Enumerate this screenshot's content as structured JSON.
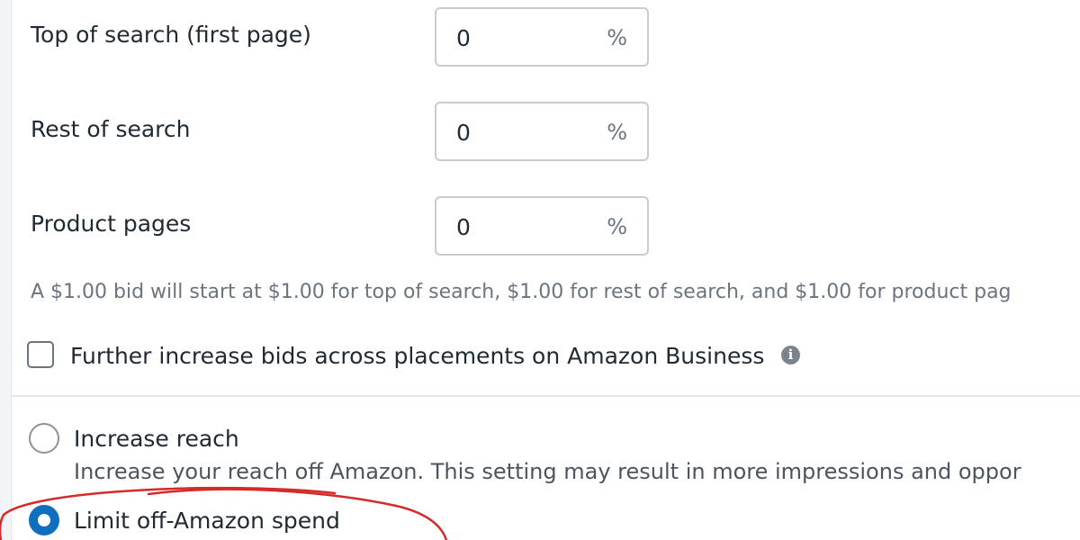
{
  "placements": {
    "rows": [
      {
        "label": "Top of search (first page)",
        "value": "0",
        "unit": "%"
      },
      {
        "label": "Rest of search",
        "value": "0",
        "unit": "%"
      },
      {
        "label": "Product pages",
        "value": "0",
        "unit": "%"
      }
    ],
    "helper_text": "A $1.00 bid will start at $1.00 for top of search, $1.00 for rest of search, and $1.00 for product pag"
  },
  "business_checkbox": {
    "label": "Further increase bids across placements on Amazon Business",
    "checked": false,
    "info_icon": "info-icon"
  },
  "reach": {
    "options": [
      {
        "label": "Increase reach",
        "description": "Increase your reach off Amazon. This setting may result in more impressions and oppor",
        "selected": false
      },
      {
        "label": "Limit off-Amazon spend",
        "selected": true
      }
    ]
  },
  "colors": {
    "selected_radio": "#0f6fbd",
    "annotation_stroke": "#d42a2a",
    "input_border": "#c7ccd1"
  }
}
